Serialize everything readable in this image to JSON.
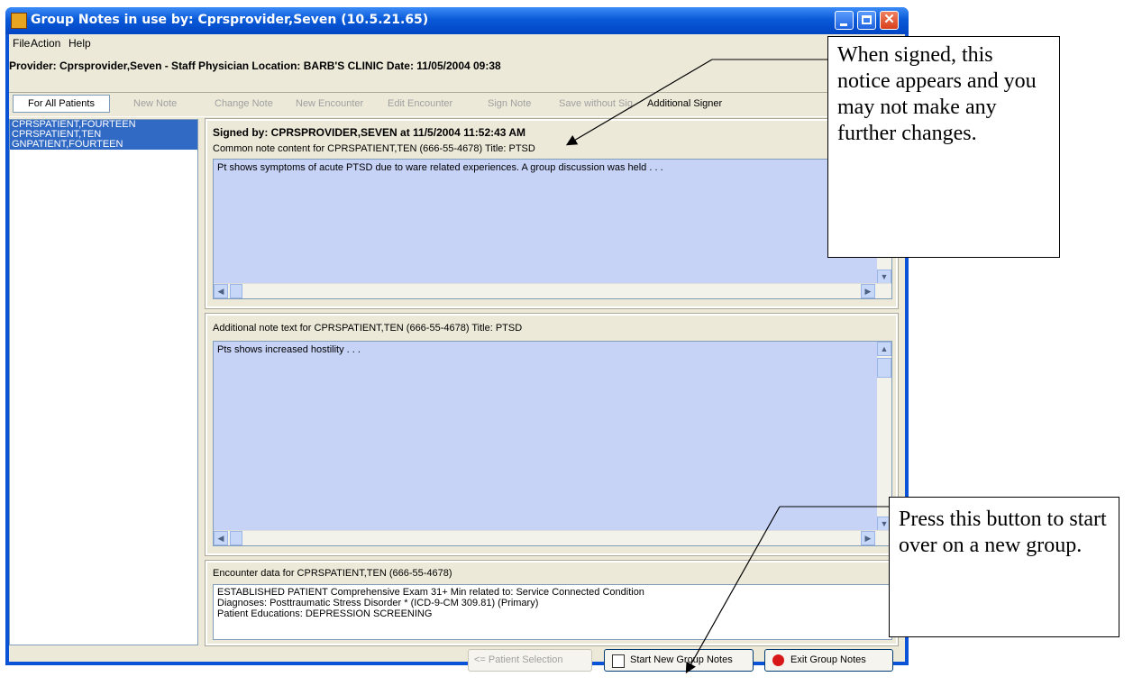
{
  "window": {
    "title": "Group Notes in use by: Cprsprovider,Seven  (10.5.21.65)"
  },
  "menu": [
    "File",
    "Action",
    "Help"
  ],
  "info": "Provider: Cprsprovider,Seven - Staff Physician  Location: BARB'S CLINIC  Date: 11/05/2004 09:38",
  "toolbar": {
    "for_all": "For All Patients",
    "new_note": "New Note",
    "change_note": "Change Note",
    "new_encounter": "New Encounter",
    "edit_encounter": "Edit Encounter",
    "sign_note": "Sign Note",
    "save_without_sig": "Save without Sig",
    "additional_signer": "Additional Signer"
  },
  "patients": [
    "CPRSPATIENT,FOURTEEN",
    "CPRSPATIENT,TEN",
    "GNPATIENT,FOURTEEN"
  ],
  "signed": "Signed by: CPRSPROVIDER,SEVEN at 11/5/2004 11:52:43 AM",
  "common_label": "Common note content for CPRSPATIENT,TEN (666-55-4678)  Title: PTSD",
  "common_text": "Pt shows symptoms of acute PTSD due to ware related experiences. A group discussion was held . . .",
  "additional_label": "Additional note text for CPRSPATIENT,TEN (666-55-4678)  Title: PTSD",
  "additional_text": "Pts shows increased hostility . . .",
  "encounter_label": "Encounter data for CPRSPATIENT,TEN (666-55-4678)",
  "encounter_lines": [
    "ESTABLISHED PATIENT Comprehensive Exam  31+ Min related to:  Service Connected Condition",
    "Diagnoses: Posttraumatic Stress Disorder * (ICD-9-CM 309.81) (Primary)",
    "Patient Educations: DEPRESSION SCREENING"
  ],
  "buttons": {
    "patient_selection": "<= Patient Selection",
    "start_new": "Start New Group Notes",
    "exit": "Exit Group Notes"
  },
  "callouts": {
    "signed_notice": "When signed, this notice appears and you may not make any further changes.",
    "start_over": "Press this button to start over on a new group."
  }
}
